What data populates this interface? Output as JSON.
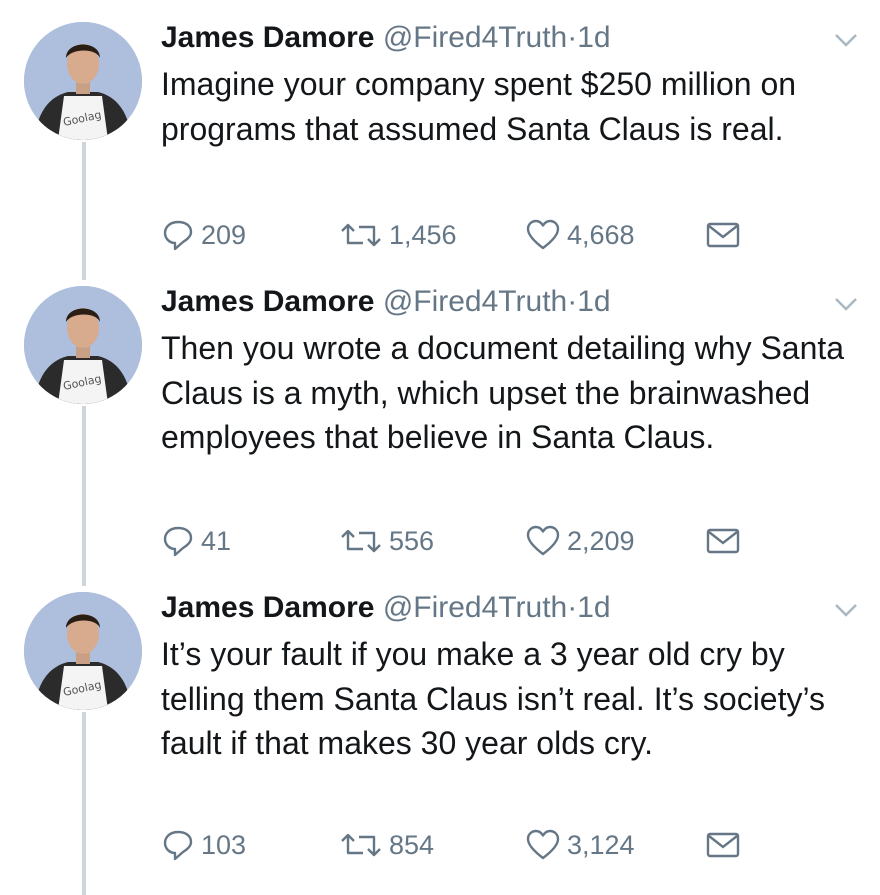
{
  "tweets": [
    {
      "name": "James Damore",
      "handle": "@Fired4Truth",
      "separator": "·",
      "time": "1d",
      "text": "Imagine your company spent $250 million on programs that assumed Santa Claus is real.",
      "replies": "209",
      "retweets": "1,456",
      "likes": "4,668",
      "avatar_shirt_text": "Goolag"
    },
    {
      "name": "James Damore",
      "handle": "@Fired4Truth",
      "separator": "·",
      "time": "1d",
      "text": "Then you wrote a document detailing why Santa Claus is a myth, which upset the brainwashed employees that believe in Santa Claus.",
      "replies": "41",
      "retweets": "556",
      "likes": "2,209",
      "avatar_shirt_text": "Goolag"
    },
    {
      "name": "James Damore",
      "handle": "@Fired4Truth",
      "separator": "·",
      "time": "1d",
      "text": "It’s your fault if you make a 3 year old cry by telling them Santa Claus isn’t real. It’s society’s fault if that makes 30 year olds cry.",
      "replies": "103",
      "retweets": "854",
      "likes": "3,124",
      "avatar_shirt_text": "Goolag"
    }
  ],
  "icons": {
    "reply": "reply-icon",
    "retweet": "retweet-icon",
    "like": "heart-icon",
    "dm": "envelope-icon",
    "menu": "chevron-down-icon"
  },
  "colors": {
    "text": "#14171a",
    "muted": "#657786",
    "thread_line": "#ccd6dd",
    "avatar_bg": "#aebfdd"
  }
}
